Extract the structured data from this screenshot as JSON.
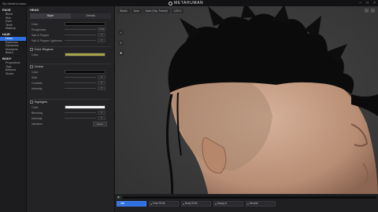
{
  "window": {
    "app_title": "My MetaHumans",
    "logo_text": "METAHUMAN"
  },
  "nav": {
    "sections": [
      {
        "title": "FACE",
        "items": [
          "Blend",
          "Skin",
          "Eyes",
          "Teeth",
          "Makeup"
        ],
        "active": -1
      },
      {
        "title": "HAIR",
        "items": [
          "Head",
          "Eyebrows",
          "Eyelashes",
          "Mustache",
          "Beard"
        ],
        "active": 0
      },
      {
        "title": "BODY",
        "items": [
          "Proportions",
          "Tops",
          "Bottoms",
          "Shoes"
        ],
        "active": -1
      }
    ]
  },
  "panel": {
    "title": "HEAD",
    "tabs": {
      "style": "Style",
      "details": "Details"
    },
    "color": {
      "label": "Color",
      "swatch": "#0a0a0a"
    },
    "roughness": {
      "label": "Roughness",
      "value": "1.00",
      "level": 1.0
    },
    "salt_pepper": {
      "label": "Salt & Pepper",
      "value": "0",
      "level": 0
    },
    "salt_pepper_lightness": {
      "label": "Salt & Pepper Lightness",
      "value": "0",
      "level": 0
    },
    "color_regions": {
      "title": "Color Regions",
      "color_label": "Color",
      "swatch": "#a8a34a"
    },
    "ombre": {
      "title": "Ombre",
      "color_label": "Color",
      "swatch": "#0a0a0a",
      "shift": {
        "label": "Shift",
        "value": "0",
        "level": 0
      },
      "contrast": {
        "label": "Contrast",
        "value": "0",
        "level": 0
      },
      "intensity": {
        "label": "Intensity",
        "value": "0",
        "level": 0
      }
    },
    "highlights": {
      "title": "Highlights",
      "color_label": "Color",
      "swatch": "#f4f4f4",
      "blending": {
        "label": "Blending",
        "value": "0",
        "level": 0
      },
      "intensity": {
        "label": "Intensity",
        "value": "0",
        "level": 0
      },
      "variation": {
        "label": "Variation",
        "reset_label": "Reset"
      }
    }
  },
  "viewport": {
    "chips": [
      "Studio",
      "Auto",
      "Eyes (Top, Tweed)",
      "LOD 0"
    ],
    "tools": [
      "+",
      "≡",
      "✥"
    ],
    "colors": {
      "background": "#3b3b3b",
      "hair": "#0b0b0b",
      "skin": "#c29a80"
    }
  },
  "bottom": {
    "play_icon": "▶",
    "animations": [
      "Idle",
      "Face ROM",
      "Body ROM",
      "Happy A",
      "Neutral"
    ],
    "active_animation": 0
  }
}
